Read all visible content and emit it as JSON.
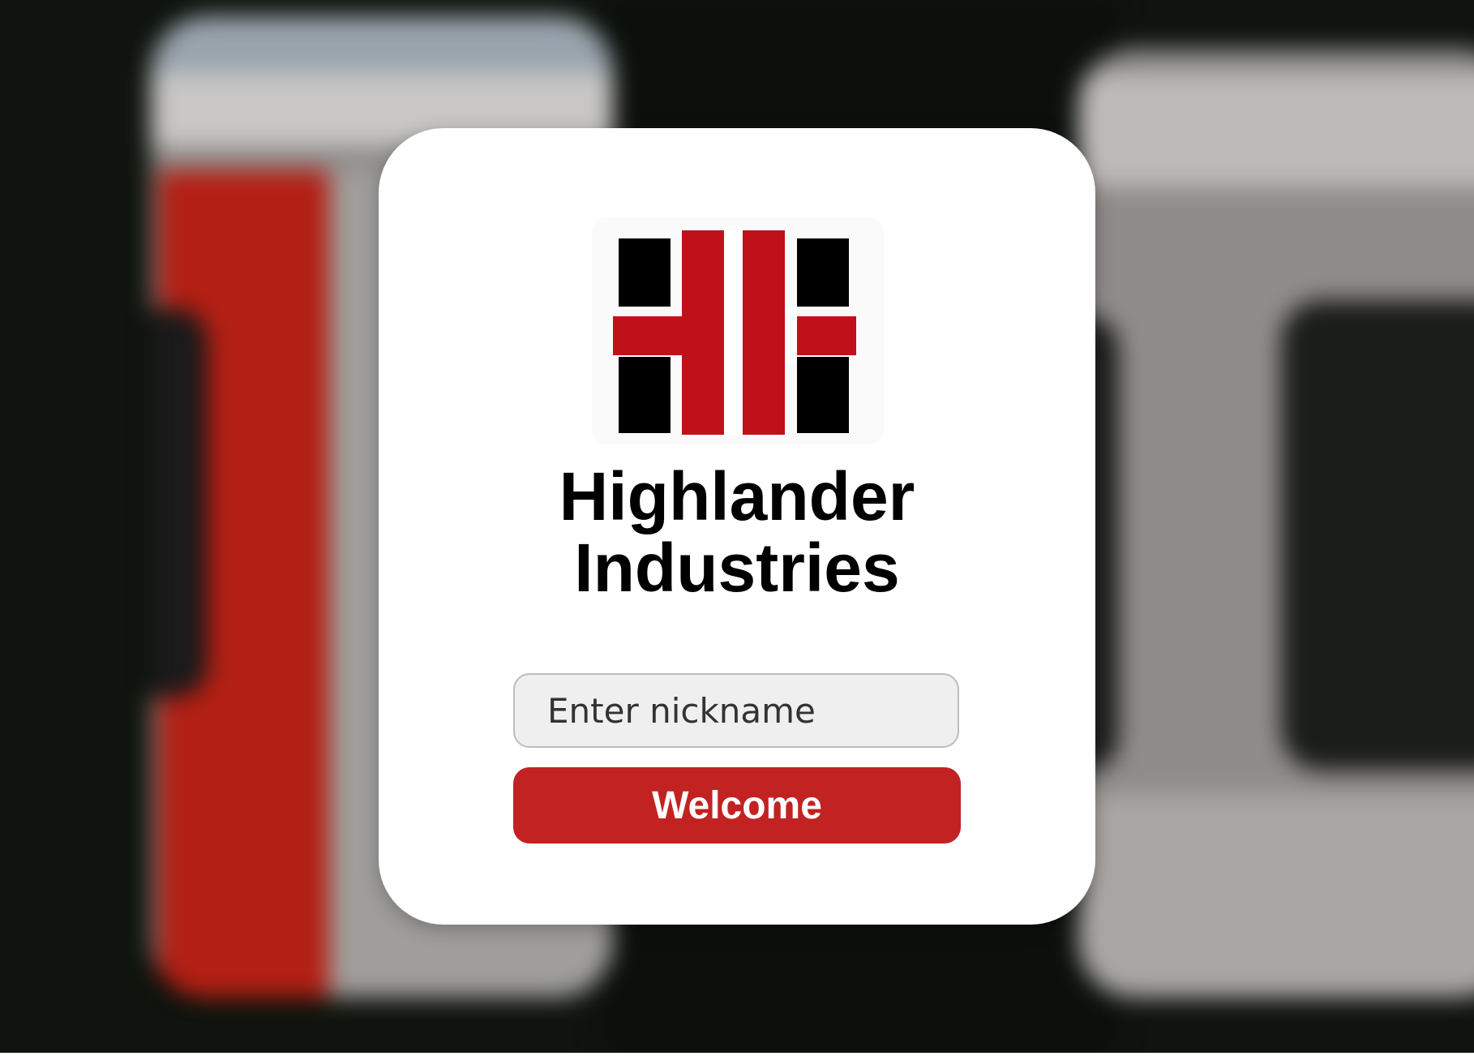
{
  "brand": {
    "line1": "Highlander",
    "line2": "Industries",
    "logo_icon": "highlander-crossed-bars-logo",
    "colors": {
      "red": "#c0111a",
      "black": "#000000"
    }
  },
  "form": {
    "nickname_placeholder": "Enter nickname",
    "nickname_value": "",
    "submit_label": "Welcome"
  },
  "theme": {
    "accent": "#c32222",
    "card_background": "#ffffff",
    "input_background": "#efefef"
  },
  "background": {
    "description_icon": "blurred-train-photo"
  }
}
